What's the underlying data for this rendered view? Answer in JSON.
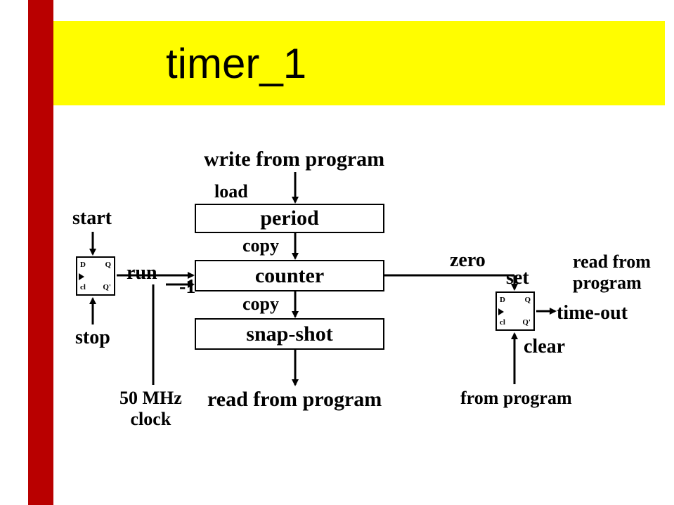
{
  "title": "timer_1",
  "labels": {
    "write_from_program": "write from program",
    "load": "load",
    "period": "period",
    "copy1": "copy",
    "counter": "counter",
    "copy2": "copy",
    "snapshot": "snap-shot",
    "read_from_program_bottom": "read from program",
    "start": "start",
    "stop": "stop",
    "run": "run",
    "minus1": "-1",
    "clock": "50 MHz\nclock",
    "clock_line1": "50 MHz",
    "clock_line2": "clock",
    "zero": "zero",
    "set": "set",
    "clear": "clear",
    "from_program": "from program",
    "read_from_program_right": "read from\nprogram",
    "read_from_program_right_line1": "read from",
    "read_from_program_right_line2": "program",
    "timeout": "time-out",
    "ff_D": "D",
    "ff_Q": "Q",
    "ff_cl": "cl",
    "ff_Qn": "Q'"
  }
}
